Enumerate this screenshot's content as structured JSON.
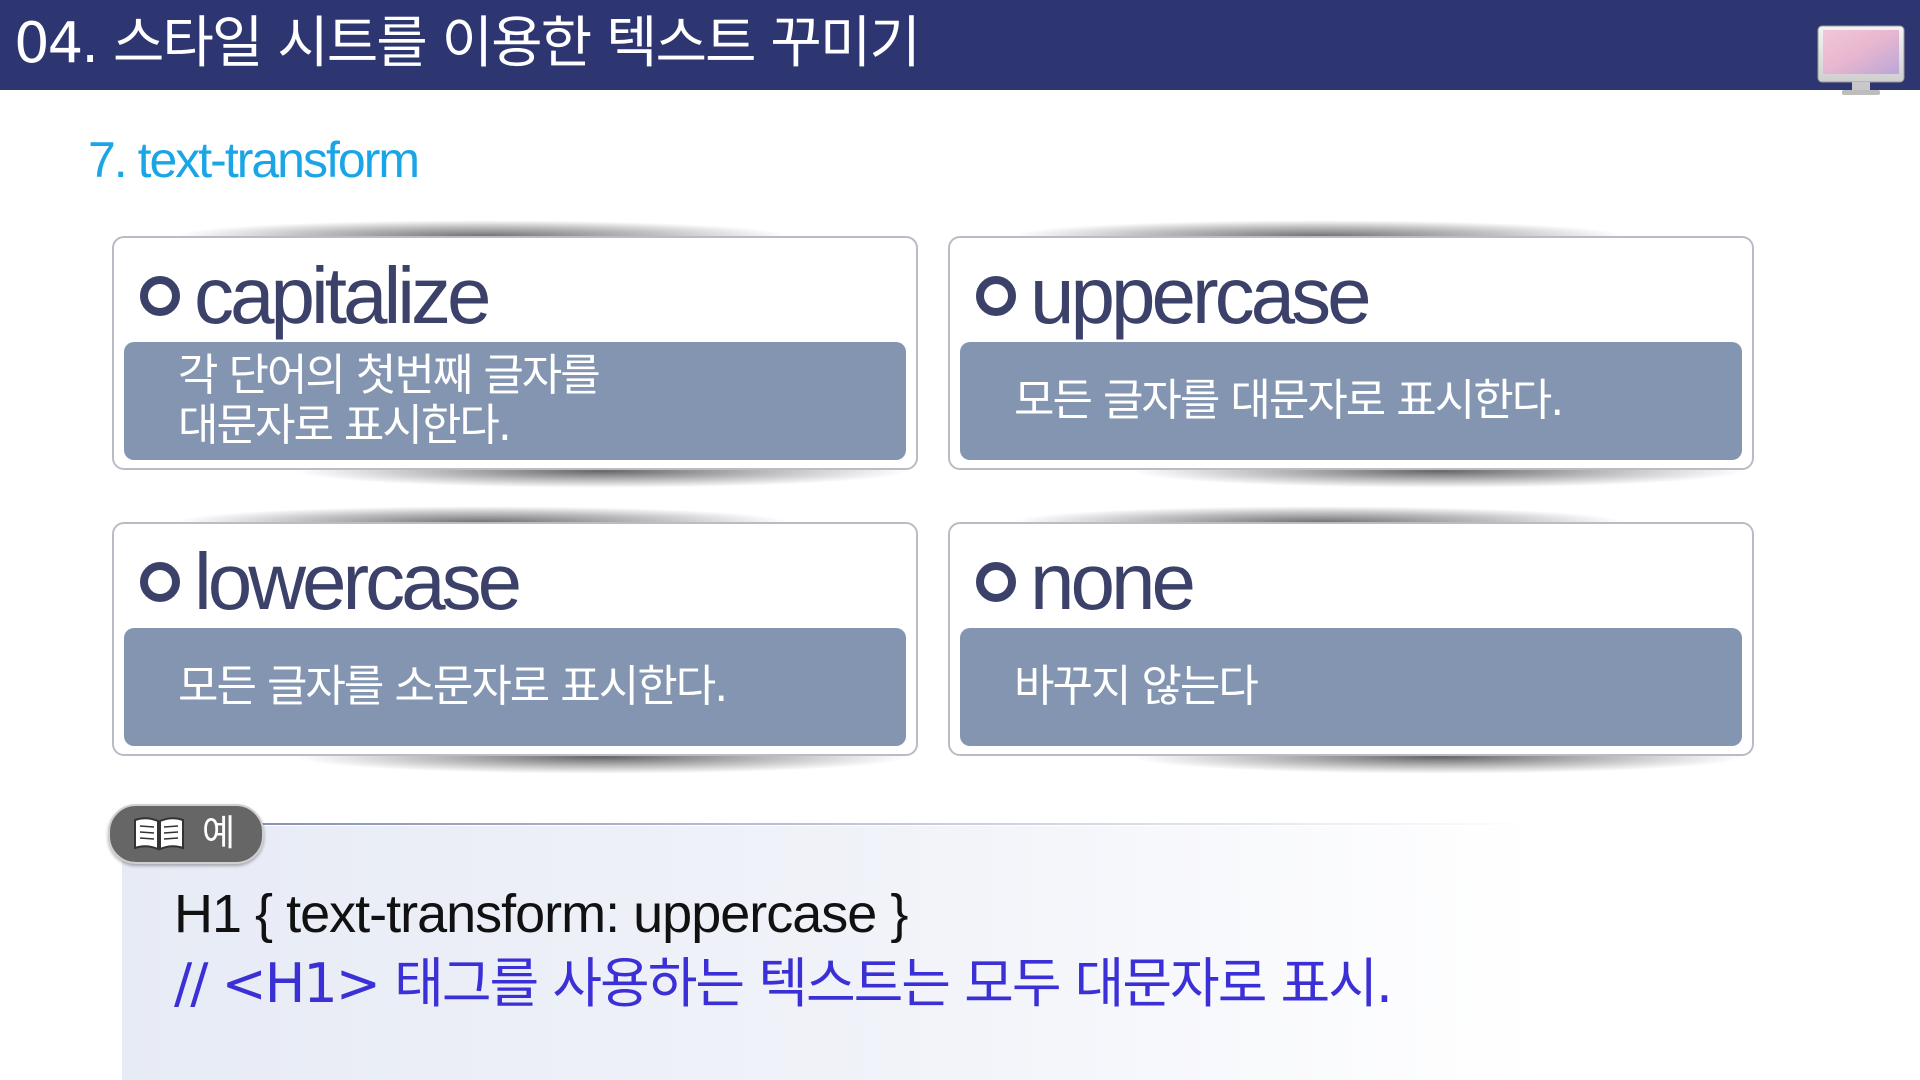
{
  "header": {
    "title": "04. 스타일 시트를 이용한 텍스트 꾸미기",
    "icon": "monitor-icon"
  },
  "section": {
    "title": "7. text-transform"
  },
  "cards": [
    {
      "keyword": "capitalize",
      "description": "각 단어의 첫번째 글자를\n대문자로 표시한다."
    },
    {
      "keyword": "uppercase",
      "description": "모든 글자를 대문자로 표시한다."
    },
    {
      "keyword": "lowercase",
      "description": "모든 글자를 소문자로 표시한다."
    },
    {
      "keyword": "none",
      "description": "바꾸지 않는다"
    }
  ],
  "example": {
    "label": "예",
    "icon": "book-icon",
    "code": "H1  { text-transform: uppercase }",
    "comment": "// <H1> 태그를 사용하는 텍스트는 모두 대문자로 표시."
  },
  "colors": {
    "header_bg": "#2e3672",
    "section_title": "#1aa6e6",
    "keyword": "#3b4168",
    "desc_bg": "#8395b0",
    "comment": "#3b2fd6"
  }
}
